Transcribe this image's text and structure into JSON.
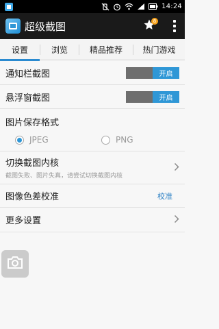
{
  "status_bar": {
    "notification_icon": "app-notification-icon",
    "time": "14:24",
    "icons": [
      "mute-icon",
      "alarm-icon",
      "wifi-icon",
      "signal-icon",
      "battery-icon"
    ]
  },
  "action_bar": {
    "title": "超级截图",
    "badge_count": "8",
    "icons": [
      "app-logo-icon",
      "star-icon",
      "overflow-menu-icon"
    ]
  },
  "tabs": [
    {
      "label": "设置",
      "active": true
    },
    {
      "label": "浏览",
      "active": false
    },
    {
      "label": "精品推荐",
      "active": false
    },
    {
      "label": "热门游戏",
      "active": false
    }
  ],
  "settings": {
    "notification_screenshot": {
      "label": "通知栏截图",
      "toggle_text": "开启"
    },
    "floating_screenshot": {
      "label": "悬浮窗截图",
      "toggle_text": "开启"
    },
    "image_format": {
      "label": "图片保存格式",
      "options": [
        "JPEG",
        "PNG"
      ],
      "selected": "JPEG"
    },
    "switch_core": {
      "label": "切换截图内核",
      "hint": "截图失败、图片失真，请尝试切换截图内核"
    },
    "color_calibration": {
      "label": "图像色差校准",
      "action": "校准"
    },
    "more_settings": {
      "label": "更多设置"
    }
  },
  "colors": {
    "accent": "#2f97d6",
    "toggle_off": "#6e6e6e",
    "action_bar": "#1a1a1a",
    "link": "#2a7fc4"
  },
  "floating_button": {
    "icon": "camera-icon"
  }
}
